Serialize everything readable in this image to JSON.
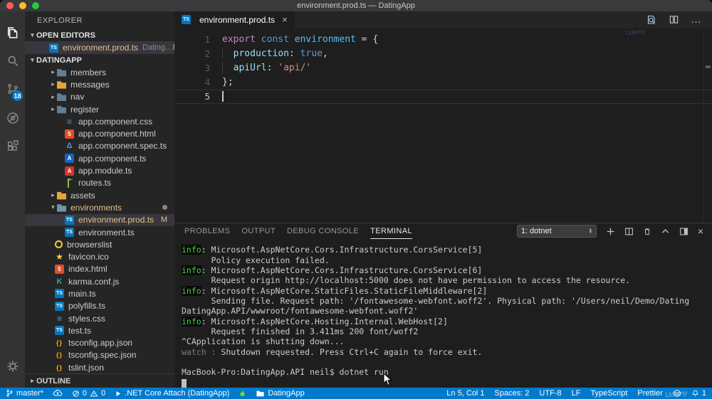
{
  "window": {
    "title": "environment.prod.ts — DatingApp"
  },
  "activity_bar": {
    "source_control_badge": "18"
  },
  "explorer": {
    "title": "EXPLORER",
    "open_editors_label": "OPEN EDITORS",
    "open_editor_file": {
      "name": "environment.prod.ts",
      "detail": "Dating…",
      "badge": "M"
    },
    "project_label": "DATINGAPP",
    "outline_label": "OUTLINE",
    "tree": [
      {
        "label": "members",
        "icon": "folder",
        "depth": 1,
        "chevron": "right"
      },
      {
        "label": "messages",
        "icon": "folder-orange",
        "depth": 1,
        "chevron": "right"
      },
      {
        "label": "nav",
        "icon": "folder",
        "depth": 1,
        "chevron": "right"
      },
      {
        "label": "register",
        "icon": "folder",
        "depth": 1,
        "chevron": "right"
      },
      {
        "label": "app.component.css",
        "icon": "css",
        "depth": 2
      },
      {
        "label": "app.component.html",
        "icon": "html",
        "depth": 2
      },
      {
        "label": "app.component.spec.ts",
        "icon": "test",
        "depth": 2
      },
      {
        "label": "app.component.ts",
        "icon": "ng",
        "depth": 2
      },
      {
        "label": "app.module.ts",
        "icon": "ng-red",
        "depth": 2
      },
      {
        "label": "routes.ts",
        "icon": "routes",
        "depth": 2
      },
      {
        "label": "assets",
        "icon": "folder-orange",
        "depth": 1,
        "chevron": "right"
      },
      {
        "label": "environments",
        "icon": "folder-open",
        "depth": 1,
        "chevron": "down",
        "modified": true,
        "dot": true
      },
      {
        "label": "environment.prod.ts",
        "icon": "ts",
        "depth": 2,
        "modified": true,
        "selected": true,
        "badge": "M"
      },
      {
        "label": "environment.ts",
        "icon": "ts",
        "depth": 2
      },
      {
        "label": "browserslist",
        "icon": "browserslist",
        "depth": 1
      },
      {
        "label": "favicon.ico",
        "icon": "star",
        "depth": 1
      },
      {
        "label": "index.html",
        "icon": "html",
        "depth": 1
      },
      {
        "label": "karma.conf.js",
        "icon": "karma",
        "depth": 1
      },
      {
        "label": "main.ts",
        "icon": "ts",
        "depth": 1
      },
      {
        "label": "polyfills.ts",
        "icon": "ts",
        "depth": 1
      },
      {
        "label": "styles.css",
        "icon": "css",
        "depth": 1
      },
      {
        "label": "test.ts",
        "icon": "ts",
        "depth": 1
      },
      {
        "label": "tsconfig.app.json",
        "icon": "json",
        "depth": 1
      },
      {
        "label": "tsconfig.spec.json",
        "icon": "json",
        "depth": 1
      },
      {
        "label": "tslint.json",
        "icon": "json",
        "depth": 1
      }
    ]
  },
  "editor": {
    "tab": {
      "title": "environment.prod.ts",
      "close": "×"
    },
    "code_lines": [
      {
        "num": "1",
        "tokens": [
          {
            "t": "export",
            "c": "k1"
          },
          {
            "t": " ",
            "c": "p"
          },
          {
            "t": "const",
            "c": "k2"
          },
          {
            "t": " ",
            "c": "p"
          },
          {
            "t": "environment",
            "c": "cv"
          },
          {
            "t": " = {",
            "c": "p"
          }
        ]
      },
      {
        "num": "2",
        "tokens": [
          {
            "t": "  ",
            "c": "p ind"
          },
          {
            "t": "production",
            "c": "v"
          },
          {
            "t": ": ",
            "c": "p"
          },
          {
            "t": "true",
            "c": "k2"
          },
          {
            "t": ",",
            "c": "p"
          }
        ]
      },
      {
        "num": "3",
        "tokens": [
          {
            "t": "  ",
            "c": "p ind"
          },
          {
            "t": "apiUrl",
            "c": "v"
          },
          {
            "t": ": ",
            "c": "p"
          },
          {
            "t": "'api/'",
            "c": "s"
          }
        ]
      },
      {
        "num": "4",
        "tokens": [
          {
            "t": "};",
            "c": "p"
          }
        ]
      },
      {
        "num": "5",
        "tokens": [],
        "cursor": true
      }
    ]
  },
  "panel": {
    "tabs": [
      "PROBLEMS",
      "OUTPUT",
      "DEBUG CONSOLE",
      "TERMINAL"
    ],
    "active_tab": "TERMINAL",
    "terminal_select": "1: dotnet",
    "terminal": [
      [
        {
          "t": "info",
          "c": "g"
        },
        {
          "t": ": Microsoft.AspNetCore.Cors.Infrastructure.CorsService[5]",
          "c": "n"
        }
      ],
      [
        {
          "t": "      Policy execution failed.",
          "c": "n"
        }
      ],
      [
        {
          "t": "info",
          "c": "g"
        },
        {
          "t": ": Microsoft.AspNetCore.Cors.Infrastructure.CorsService[6]",
          "c": "n"
        }
      ],
      [
        {
          "t": "      Request origin http://localhost:5000 does not have permission to access the resource.",
          "c": "n"
        }
      ],
      [
        {
          "t": "info",
          "c": "g"
        },
        {
          "t": ": Microsoft.AspNetCore.StaticFiles.StaticFileMiddleware[2]",
          "c": "n"
        }
      ],
      [
        {
          "t": "      Sending file. Request path: '/fontawesome-webfont.woff2'. Physical path: '/Users/neil/Demo/Dating",
          "c": "n"
        }
      ],
      [
        {
          "t": "DatingApp.API/wwwroot/fontawesome-webfont.woff2'",
          "c": "n"
        }
      ],
      [
        {
          "t": "info",
          "c": "g"
        },
        {
          "t": ": Microsoft.AspNetCore.Hosting.Internal.WebHost[2]",
          "c": "n"
        }
      ],
      [
        {
          "t": "      Request finished in 3.411ms 200 font/woff2",
          "c": "n"
        }
      ],
      [
        {
          "t": "^CApplication is shutting down...",
          "c": "n"
        }
      ],
      [
        {
          "t": "watch : ",
          "c": "d"
        },
        {
          "t": "Shutdown requested. Press Ctrl+C again to force exit.",
          "c": "n"
        }
      ],
      [],
      [
        {
          "t": "MacBook-Pro:DatingApp.API neil$ dotnet run",
          "c": "n"
        }
      ],
      [
        {
          "t": "",
          "c": "cursor"
        }
      ]
    ]
  },
  "status_bar": {
    "branch": "master*",
    "errors": "0",
    "warnings": "0",
    "debug_config": ".NET Core Attach (DatingApp)",
    "folder": "DatingApp",
    "line_col": "Ln 5, Col 1",
    "spaces": "Spaces: 2",
    "encoding": "UTF-8",
    "eol": "LF",
    "language": "TypeScript",
    "formatter": "Prettier",
    "bell_count": "1"
  },
  "watermark": "Udemy",
  "colors": {
    "accent": "#007acc",
    "modified": "#e2c08d",
    "info_green": "#3ed43e",
    "status_bar": "#007acc"
  }
}
